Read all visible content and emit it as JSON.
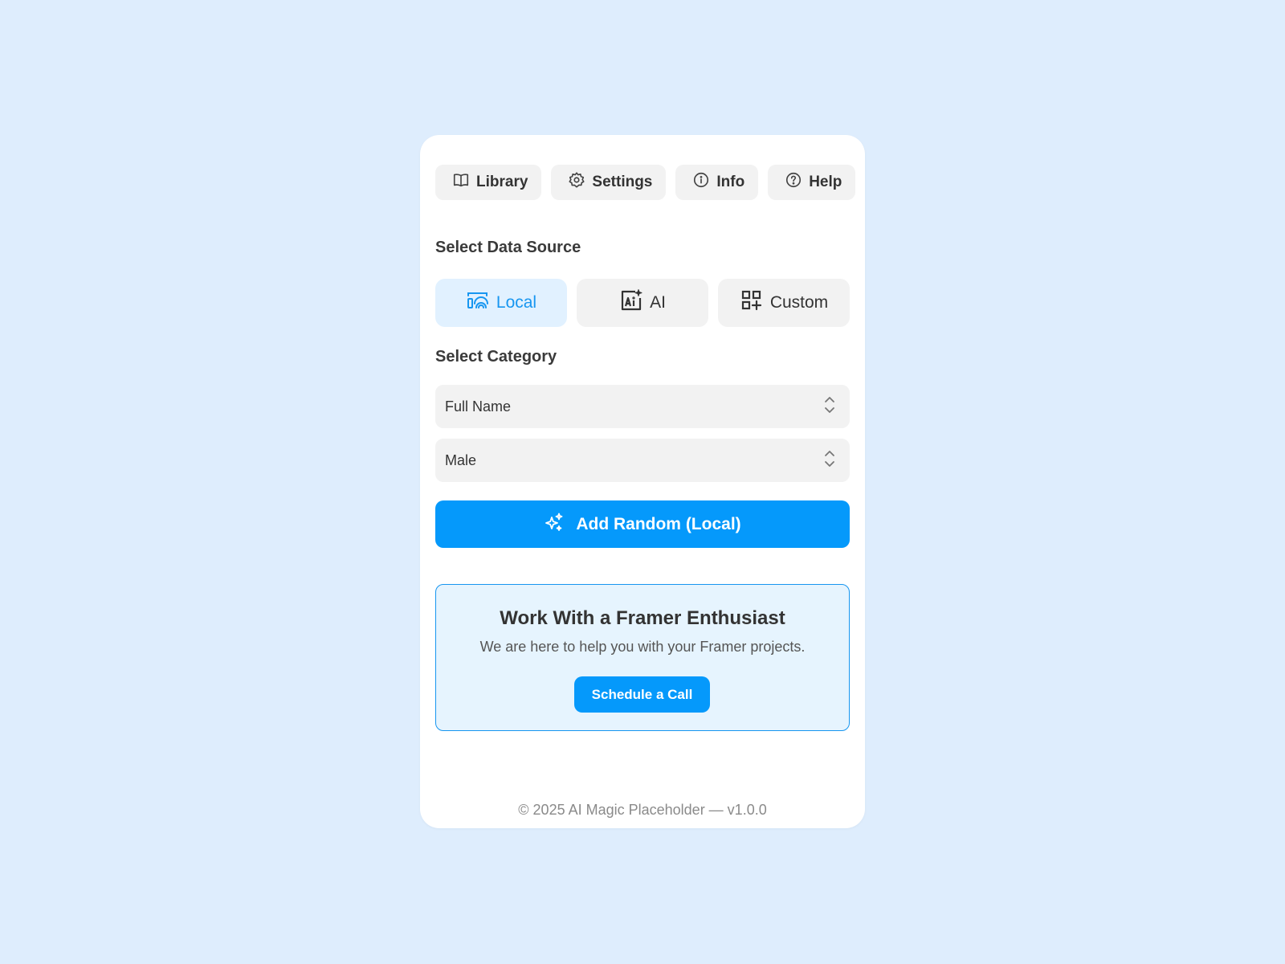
{
  "toolbar": {
    "items": [
      {
        "label": "Library",
        "icon": "book-icon"
      },
      {
        "label": "Settings",
        "icon": "gear-icon"
      },
      {
        "label": "Info",
        "icon": "info-icon"
      },
      {
        "label": "Help",
        "icon": "question-icon"
      }
    ]
  },
  "data_source": {
    "label": "Select Data Source",
    "options": [
      {
        "label": "Local",
        "icon": "local-data-icon",
        "active": true
      },
      {
        "label": "AI",
        "icon": "ai-sparkle-icon",
        "active": false
      },
      {
        "label": "Custom",
        "icon": "grid-plus-icon",
        "active": false
      }
    ]
  },
  "category": {
    "label": "Select Category",
    "selects": [
      {
        "value": "Full Name"
      },
      {
        "value": "Male"
      }
    ]
  },
  "primary_action": {
    "label": "Add Random (Local)",
    "icon": "sparkles-icon"
  },
  "promo": {
    "title": "Work With a Framer Enthusiast",
    "subtitle": "We are here to help you with your Framer projects.",
    "button_label": "Schedule a Call"
  },
  "footer": {
    "text": "© 2025 AI Magic Placeholder — v1.0.0"
  },
  "colors": {
    "background": "#deedfd",
    "accent": "#0599fb",
    "active_tab_bg": "#e1f1ff",
    "active_tab_text": "#1796f0"
  }
}
